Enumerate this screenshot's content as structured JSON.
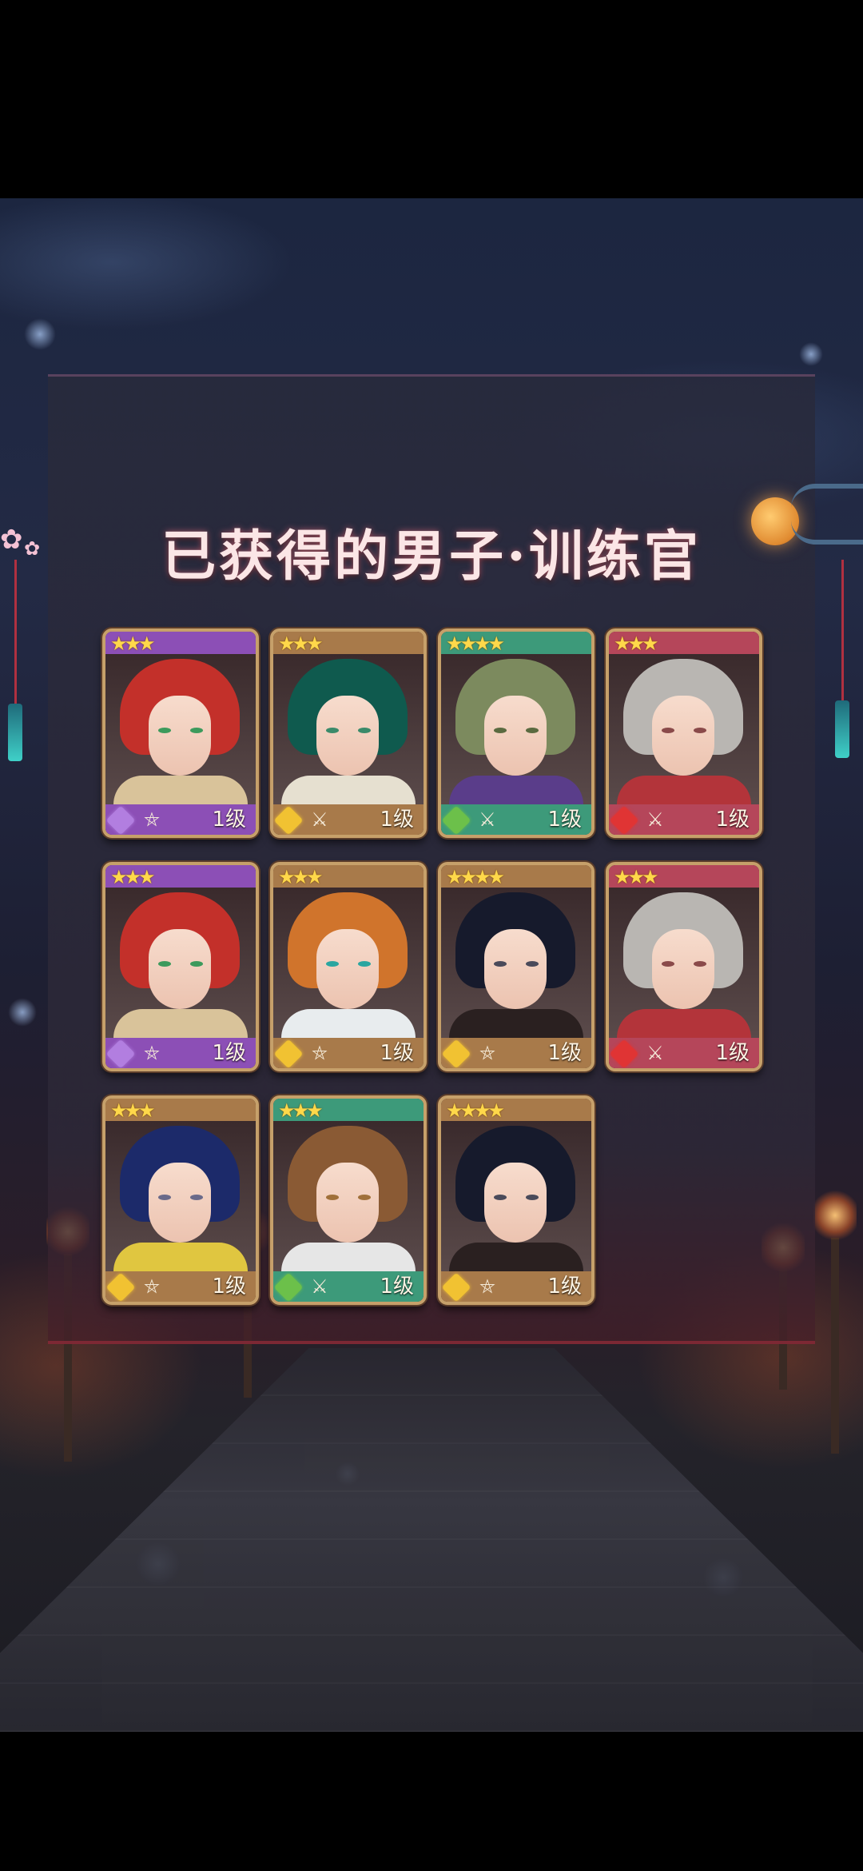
{
  "title": "已获得的男子·训练官",
  "theme": {
    "purple": "#8c4fb6",
    "brown": "#a87a4a",
    "green": "#3d9a7a",
    "red": "#b5465a"
  },
  "cards": [
    {
      "stars": "★★★",
      "frame": "purple",
      "hair": "#c3302a",
      "eyes": "#3c9a5c",
      "cloth": "#d9c39a",
      "attr_icon": "amethyst-gem-icon",
      "attr_color": "#b27ee0",
      "weapon_icon": "pentagram-icon",
      "weapon_glyph": "⛤",
      "level": "1级"
    },
    {
      "stars": "★★★",
      "frame": "brown",
      "hair": "#0f5a4e",
      "eyes": "#3a8a6a",
      "cloth": "#e6e0d0",
      "attr_icon": "gold-gem-icon",
      "attr_color": "#f1c232",
      "weapon_icon": "crossed-swords-icon",
      "weapon_glyph": "⚔",
      "level": "1级"
    },
    {
      "stars": "★★★★",
      "frame": "green",
      "hair": "#7c8a5e",
      "eyes": "#5a6a40",
      "cloth": "#5a3d8a",
      "attr_icon": "leaf-gem-icon",
      "attr_color": "#6cc04a",
      "weapon_icon": "crossed-swords-icon",
      "weapon_glyph": "⚔",
      "level": "1级"
    },
    {
      "stars": "★★★",
      "frame": "red",
      "hair": "#b9b6b2",
      "eyes": "#8a4a4a",
      "cloth": "#b3343a",
      "attr_icon": "ruby-gem-icon",
      "attr_color": "#e03434",
      "weapon_icon": "crossed-swords-icon",
      "weapon_glyph": "⚔",
      "level": "1级"
    },
    {
      "stars": "★★★",
      "frame": "purple",
      "hair": "#c3302a",
      "eyes": "#3c9a5c",
      "cloth": "#d9c39a",
      "attr_icon": "amethyst-gem-icon",
      "attr_color": "#b27ee0",
      "weapon_icon": "pentagram-icon",
      "weapon_glyph": "⛤",
      "level": "1级"
    },
    {
      "stars": "★★★",
      "frame": "brown",
      "hair": "#d0742c",
      "eyes": "#2aa6a0",
      "cloth": "#e8ecee",
      "attr_icon": "gold-gem-icon",
      "attr_color": "#f1c232",
      "weapon_icon": "pentagram-icon",
      "weapon_glyph": "⛤",
      "level": "1级"
    },
    {
      "stars": "★★★★",
      "frame": "brown",
      "hair": "#161a2c",
      "eyes": "#4a4a5a",
      "cloth": "#2a2020",
      "attr_icon": "gold-gem-icon",
      "attr_color": "#f1c232",
      "weapon_icon": "pentagram-icon",
      "weapon_glyph": "⛤",
      "level": "1级"
    },
    {
      "stars": "★★★",
      "frame": "red",
      "hair": "#b9b6b2",
      "eyes": "#8a4a4a",
      "cloth": "#b3343a",
      "attr_icon": "ruby-gem-icon",
      "attr_color": "#e03434",
      "weapon_icon": "crossed-swords-icon",
      "weapon_glyph": "⚔",
      "level": "1级"
    },
    {
      "stars": "★★★",
      "frame": "brown",
      "hair": "#1c2a6a",
      "eyes": "#6a6a8a",
      "cloth": "#e0c640",
      "attr_icon": "gold-gem-icon",
      "attr_color": "#f1c232",
      "weapon_icon": "pentagram-icon",
      "weapon_glyph": "⛤",
      "level": "1级"
    },
    {
      "stars": "★★★",
      "frame": "green",
      "hair": "#8a5a34",
      "eyes": "#a0703a",
      "cloth": "#e6e6e6",
      "attr_icon": "leaf-gem-icon",
      "attr_color": "#6cc04a",
      "weapon_icon": "crossed-swords-icon",
      "weapon_glyph": "⚔",
      "level": "1级"
    },
    {
      "stars": "★★★★",
      "frame": "brown",
      "hair": "#161a2c",
      "eyes": "#4a4a5a",
      "cloth": "#2a2020",
      "attr_icon": "gold-gem-icon",
      "attr_color": "#f1c232",
      "weapon_icon": "pentagram-icon",
      "weapon_glyph": "⛤",
      "level": "1级"
    }
  ]
}
